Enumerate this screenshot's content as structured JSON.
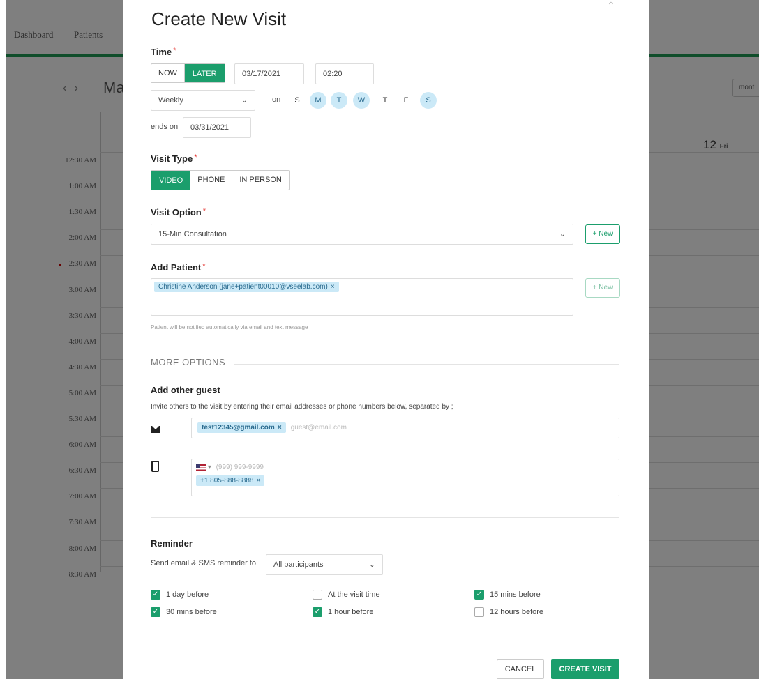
{
  "background": {
    "nav": [
      "Dashboard",
      "Patients"
    ],
    "calendar_title": "Ma",
    "view_button": "mont",
    "day_header": "12",
    "day_header_suffix": "Fri",
    "times": [
      "12:30 AM",
      "1:00 AM",
      "1:30 AM",
      "2:00 AM",
      "2:30 AM",
      "3:00 AM",
      "3:30 AM",
      "4:00 AM",
      "4:30 AM",
      "5:00 AM",
      "5:30 AM",
      "6:00 AM",
      "6:30 AM",
      "7:00 AM",
      "7:30 AM",
      "8:00 AM",
      "8:30 AM"
    ]
  },
  "modal": {
    "title": "Create New Visit",
    "close_icon": "chevron-up-icon",
    "time": {
      "label": "Time",
      "now": "NOW",
      "later": "LATER",
      "date": "03/17/2021",
      "clock": "02:20",
      "repeat": "Weekly",
      "on_label": "on",
      "days": [
        {
          "d": "S",
          "on": false
        },
        {
          "d": "M",
          "on": true
        },
        {
          "d": "T",
          "on": true
        },
        {
          "d": "W",
          "on": true
        },
        {
          "d": "T",
          "on": false
        },
        {
          "d": "F",
          "on": false
        },
        {
          "d": "S",
          "on": true
        }
      ],
      "ends_on_label": "ends on",
      "ends_on": "03/31/2021"
    },
    "visit_type": {
      "label": "Visit Type",
      "options": [
        "VIDEO",
        "PHONE",
        "IN PERSON"
      ],
      "selected": "VIDEO"
    },
    "visit_option": {
      "label": "Visit Option",
      "value": "15-Min Consultation",
      "new_button": "+ New"
    },
    "add_patient": {
      "label": "Add Patient",
      "patient": "Christine Anderson (jane+patient00010@vseelab.com)",
      "new_button": "+ New",
      "hint": "Patient will be notified automatically via email and text message"
    },
    "more_options": "MORE OPTIONS",
    "guest": {
      "label": "Add other guest",
      "description": "Invite others to the visit by entering their email addresses or phone numbers below, separated by ;",
      "email_chip": "test12345@gmail.com",
      "email_placeholder": "guest@email.com",
      "phone_placeholder": "(999) 999-9999",
      "phone_chip": "+1 805-888-8888"
    },
    "reminder": {
      "label": "Reminder",
      "send_label": "Send email & SMS reminder to",
      "recipients": "All participants",
      "options": [
        {
          "label": "1 day before",
          "checked": true
        },
        {
          "label": "At the visit time",
          "checked": false
        },
        {
          "label": "15 mins before",
          "checked": true
        },
        {
          "label": "30 mins before",
          "checked": true
        },
        {
          "label": "1 hour before",
          "checked": true
        },
        {
          "label": "12 hours before",
          "checked": false
        }
      ]
    },
    "cancel": "CANCEL",
    "create": "CREATE VISIT",
    "accent": "#1b9e6c",
    "chip_color": "#cbe9f7"
  }
}
